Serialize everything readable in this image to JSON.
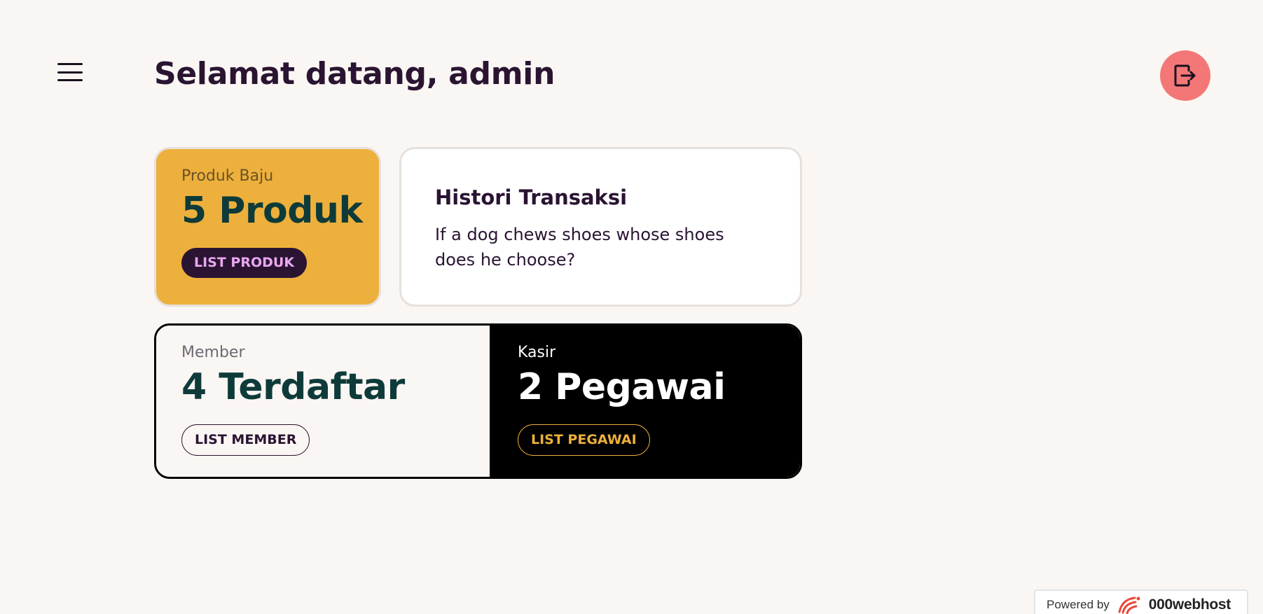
{
  "header": {
    "title": "Selamat datang, admin",
    "menu_icon": "hamburger-icon",
    "logout_icon": "logout-icon",
    "logout_color": "#f47777"
  },
  "cards": {
    "produk": {
      "label": "Produk Baju",
      "value": "5 Produk",
      "button": "LIST PRODUK",
      "color": "#edb03c"
    },
    "histori": {
      "title": "Histori Transaksi",
      "text": "If a dog chews shoes whose shoes does he choose?"
    },
    "member": {
      "label": "Member",
      "value": "4 Terdaftar",
      "button": "LIST MEMBER"
    },
    "kasir": {
      "label": "Kasir",
      "value": "2 Pegawai",
      "button": "LIST PEGAWAI",
      "color": "#000000"
    }
  },
  "footer": {
    "powered_label": "Powered by",
    "brand": "000webhost",
    "brand_icon": "webhost-logo-icon"
  }
}
